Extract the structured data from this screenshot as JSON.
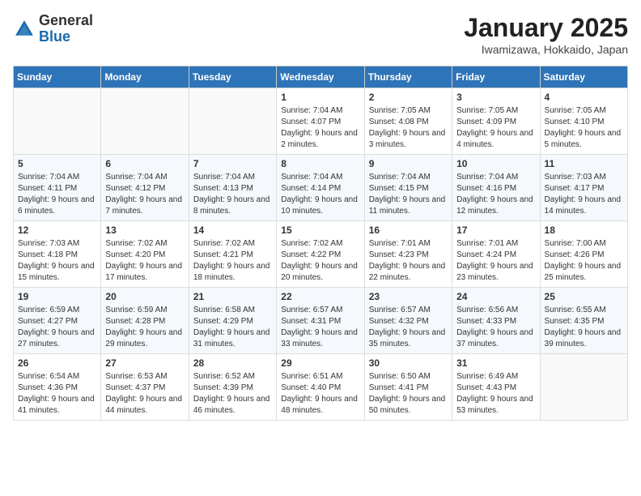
{
  "header": {
    "logo_general": "General",
    "logo_blue": "Blue",
    "month_title": "January 2025",
    "location": "Iwamizawa, Hokkaido, Japan"
  },
  "days_of_week": [
    "Sunday",
    "Monday",
    "Tuesday",
    "Wednesday",
    "Thursday",
    "Friday",
    "Saturday"
  ],
  "weeks": [
    [
      {
        "day": "",
        "info": ""
      },
      {
        "day": "",
        "info": ""
      },
      {
        "day": "",
        "info": ""
      },
      {
        "day": "1",
        "info": "Sunrise: 7:04 AM\nSunset: 4:07 PM\nDaylight: 9 hours and 2 minutes."
      },
      {
        "day": "2",
        "info": "Sunrise: 7:05 AM\nSunset: 4:08 PM\nDaylight: 9 hours and 3 minutes."
      },
      {
        "day": "3",
        "info": "Sunrise: 7:05 AM\nSunset: 4:09 PM\nDaylight: 9 hours and 4 minutes."
      },
      {
        "day": "4",
        "info": "Sunrise: 7:05 AM\nSunset: 4:10 PM\nDaylight: 9 hours and 5 minutes."
      }
    ],
    [
      {
        "day": "5",
        "info": "Sunrise: 7:04 AM\nSunset: 4:11 PM\nDaylight: 9 hours and 6 minutes."
      },
      {
        "day": "6",
        "info": "Sunrise: 7:04 AM\nSunset: 4:12 PM\nDaylight: 9 hours and 7 minutes."
      },
      {
        "day": "7",
        "info": "Sunrise: 7:04 AM\nSunset: 4:13 PM\nDaylight: 9 hours and 8 minutes."
      },
      {
        "day": "8",
        "info": "Sunrise: 7:04 AM\nSunset: 4:14 PM\nDaylight: 9 hours and 10 minutes."
      },
      {
        "day": "9",
        "info": "Sunrise: 7:04 AM\nSunset: 4:15 PM\nDaylight: 9 hours and 11 minutes."
      },
      {
        "day": "10",
        "info": "Sunrise: 7:04 AM\nSunset: 4:16 PM\nDaylight: 9 hours and 12 minutes."
      },
      {
        "day": "11",
        "info": "Sunrise: 7:03 AM\nSunset: 4:17 PM\nDaylight: 9 hours and 14 minutes."
      }
    ],
    [
      {
        "day": "12",
        "info": "Sunrise: 7:03 AM\nSunset: 4:18 PM\nDaylight: 9 hours and 15 minutes."
      },
      {
        "day": "13",
        "info": "Sunrise: 7:02 AM\nSunset: 4:20 PM\nDaylight: 9 hours and 17 minutes."
      },
      {
        "day": "14",
        "info": "Sunrise: 7:02 AM\nSunset: 4:21 PM\nDaylight: 9 hours and 18 minutes."
      },
      {
        "day": "15",
        "info": "Sunrise: 7:02 AM\nSunset: 4:22 PM\nDaylight: 9 hours and 20 minutes."
      },
      {
        "day": "16",
        "info": "Sunrise: 7:01 AM\nSunset: 4:23 PM\nDaylight: 9 hours and 22 minutes."
      },
      {
        "day": "17",
        "info": "Sunrise: 7:01 AM\nSunset: 4:24 PM\nDaylight: 9 hours and 23 minutes."
      },
      {
        "day": "18",
        "info": "Sunrise: 7:00 AM\nSunset: 4:26 PM\nDaylight: 9 hours and 25 minutes."
      }
    ],
    [
      {
        "day": "19",
        "info": "Sunrise: 6:59 AM\nSunset: 4:27 PM\nDaylight: 9 hours and 27 minutes."
      },
      {
        "day": "20",
        "info": "Sunrise: 6:59 AM\nSunset: 4:28 PM\nDaylight: 9 hours and 29 minutes."
      },
      {
        "day": "21",
        "info": "Sunrise: 6:58 AM\nSunset: 4:29 PM\nDaylight: 9 hours and 31 minutes."
      },
      {
        "day": "22",
        "info": "Sunrise: 6:57 AM\nSunset: 4:31 PM\nDaylight: 9 hours and 33 minutes."
      },
      {
        "day": "23",
        "info": "Sunrise: 6:57 AM\nSunset: 4:32 PM\nDaylight: 9 hours and 35 minutes."
      },
      {
        "day": "24",
        "info": "Sunrise: 6:56 AM\nSunset: 4:33 PM\nDaylight: 9 hours and 37 minutes."
      },
      {
        "day": "25",
        "info": "Sunrise: 6:55 AM\nSunset: 4:35 PM\nDaylight: 9 hours and 39 minutes."
      }
    ],
    [
      {
        "day": "26",
        "info": "Sunrise: 6:54 AM\nSunset: 4:36 PM\nDaylight: 9 hours and 41 minutes."
      },
      {
        "day": "27",
        "info": "Sunrise: 6:53 AM\nSunset: 4:37 PM\nDaylight: 9 hours and 44 minutes."
      },
      {
        "day": "28",
        "info": "Sunrise: 6:52 AM\nSunset: 4:39 PM\nDaylight: 9 hours and 46 minutes."
      },
      {
        "day": "29",
        "info": "Sunrise: 6:51 AM\nSunset: 4:40 PM\nDaylight: 9 hours and 48 minutes."
      },
      {
        "day": "30",
        "info": "Sunrise: 6:50 AM\nSunset: 4:41 PM\nDaylight: 9 hours and 50 minutes."
      },
      {
        "day": "31",
        "info": "Sunrise: 6:49 AM\nSunset: 4:43 PM\nDaylight: 9 hours and 53 minutes."
      },
      {
        "day": "",
        "info": ""
      }
    ]
  ]
}
